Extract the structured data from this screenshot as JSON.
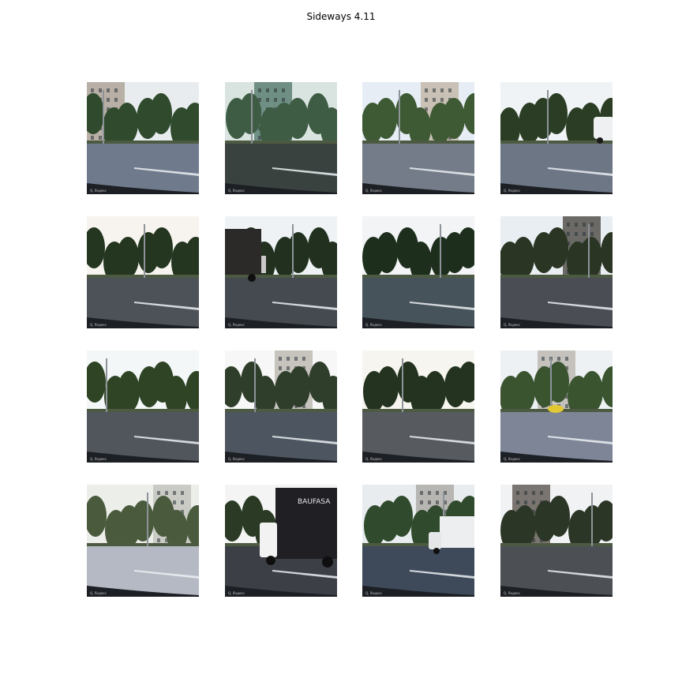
{
  "title": "Sideways 4.11",
  "tiles": [
    {
      "id": "r1c1",
      "sky": "#e8ecef",
      "trees": "#2f4a2c",
      "road": "#6f7a8c",
      "building": "#b8b0a6",
      "vehicle": ""
    },
    {
      "id": "r1c2",
      "sky": "#d9e4e1",
      "trees": "#3e5c44",
      "road": "#3a423f",
      "building": "#6f8f84",
      "vehicle": ""
    },
    {
      "id": "r1c3",
      "sky": "#e6edf4",
      "trees": "#3e5a34",
      "road": "#737c88",
      "building": "#c9c1b6",
      "vehicle": ""
    },
    {
      "id": "r1c4",
      "sky": "#f0f3f5",
      "trees": "#2b3e25",
      "road": "#6d7685",
      "building": "",
      "vehicle": "van"
    },
    {
      "id": "r2c1",
      "sky": "#f7f4ef",
      "trees": "#243620",
      "road": "#4d5258",
      "building": "",
      "vehicle": ""
    },
    {
      "id": "r2c2",
      "sky": "#eef2f4",
      "trees": "#22311f",
      "road": "#444a4f",
      "building": "",
      "vehicle": "box-truck"
    },
    {
      "id": "r2c3",
      "sky": "#f2f4f6",
      "trees": "#1e2e1c",
      "road": "#47535a",
      "building": "",
      "vehicle": ""
    },
    {
      "id": "r2c4",
      "sky": "#e9eef2",
      "trees": "#2a3524",
      "road": "#4a4e54",
      "building": "#6b6a66",
      "vehicle": ""
    },
    {
      "id": "r3c1",
      "sky": "#f4f7f8",
      "trees": "#2e4424",
      "road": "#51565c",
      "building": "",
      "vehicle": ""
    },
    {
      "id": "r3c2",
      "sky": "#f6f7f6",
      "trees": "#2f3e2a",
      "road": "#4d5660",
      "building": "#c7c4be",
      "vehicle": ""
    },
    {
      "id": "r3c3",
      "sky": "#f7f5ef",
      "trees": "#23331f",
      "road": "#575b60",
      "building": "",
      "vehicle": ""
    },
    {
      "id": "r3c4",
      "sky": "#eef1f4",
      "trees": "#3a5430",
      "road": "#7d8597",
      "building": "#c5c2bd",
      "vehicle": "yellow-car"
    },
    {
      "id": "r4c1",
      "sky": "#eceeea",
      "trees": "#4a5a3c",
      "road": "#b4b9c4",
      "building": "#c9cbc4",
      "vehicle": ""
    },
    {
      "id": "r4c2",
      "sky": "#f3f4f3",
      "trees": "#2a3a24",
      "road": "#3c4046",
      "building": "",
      "vehicle": "bau-truck"
    },
    {
      "id": "r4c3",
      "sky": "#e8ecef",
      "trees": "#2f4a2c",
      "road": "#3e4a5a",
      "building": "#b8b6b2",
      "vehicle": "white-truck"
    },
    {
      "id": "r4c4",
      "sky": "#f0f2f4",
      "trees": "#2c3626",
      "road": "#4c5055",
      "building": "#7a7570",
      "vehicle": ""
    }
  ],
  "truck_text": "BAUFASA",
  "watermark": "Q, Яндекс"
}
